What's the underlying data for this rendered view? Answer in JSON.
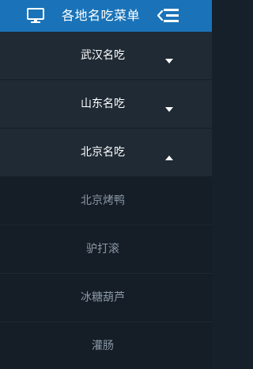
{
  "header": {
    "title": "各地名吃菜单",
    "left_icon": "monitor-icon",
    "right_icon": "menu-collapse-icon",
    "background": "#1a73b8"
  },
  "menu": {
    "items": [
      {
        "label": "武汉名吃",
        "expanded": false
      },
      {
        "label": "山东名吃",
        "expanded": false
      },
      {
        "label": "北京名吃",
        "expanded": true
      }
    ],
    "submenu": [
      {
        "label": "北京烤鸭"
      },
      {
        "label": "驴打滚"
      },
      {
        "label": "冰糖葫芦"
      },
      {
        "label": "灌肠"
      }
    ]
  }
}
